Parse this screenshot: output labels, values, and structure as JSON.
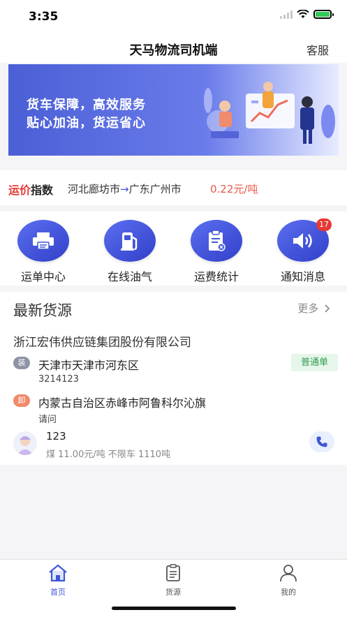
{
  "status": {
    "time": "3:35"
  },
  "header": {
    "title": "天马物流司机端",
    "right_action": "客服"
  },
  "banner": {
    "line1": "货车保障，高效服务",
    "line2": "贴心加油，货运省心"
  },
  "freight_index": {
    "title_red": "运价",
    "title_black": "指数",
    "from": "河北廊坊市",
    "arrow": "→",
    "to": "广东广州市",
    "price": "0.22元/吨"
  },
  "quick_menu": [
    {
      "label": "运单中心",
      "icon": "printer-icon"
    },
    {
      "label": "在线油气",
      "icon": "gas-pump-icon"
    },
    {
      "label": "运费统计",
      "icon": "clipboard-icon"
    },
    {
      "label": "通知消息",
      "icon": "speaker-icon",
      "badge": "17"
    }
  ],
  "cargo": {
    "title": "最新货源",
    "more": "更多",
    "company": "浙江宏伟供应链集团股份有限公司",
    "load_tag": "装",
    "load_addr": "天津市天津市河东区",
    "load_sub": "3214123",
    "type_badge": "普通单",
    "unload_tag": "卸",
    "unload_addr": "内蒙古自治区赤峰市阿鲁科尔沁旗",
    "unload_sub": "请问",
    "contact_name": "123",
    "contact_info": "煤 11.00元/吨 不限车 1110吨"
  },
  "tabs": [
    {
      "label": "首页",
      "icon": "home-icon",
      "active": true
    },
    {
      "label": "货源",
      "icon": "document-icon",
      "active": false
    },
    {
      "label": "我的",
      "icon": "user-icon",
      "active": false
    }
  ],
  "colors": {
    "primary": "#3f57d4",
    "price": "#e8594b",
    "badge": "#e53935",
    "tag_load": "#8e93a6",
    "tag_unload": "#f08a6a"
  }
}
